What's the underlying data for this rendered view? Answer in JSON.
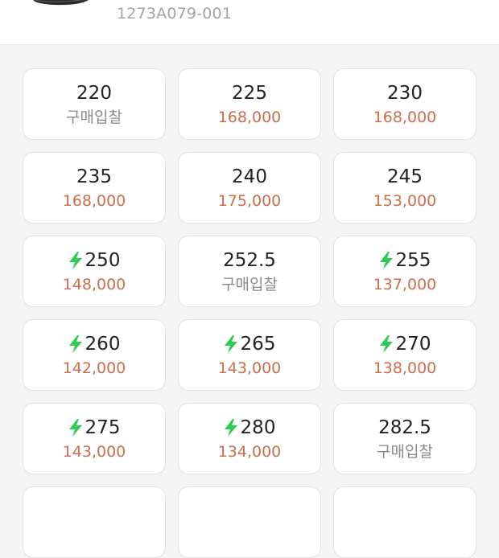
{
  "header": {
    "model_code": "1273A079-001",
    "thumbnail_icon": "shoe-thumbnail"
  },
  "colors": {
    "price": "#cc6e4c",
    "bid_text": "#8a8a8a",
    "fast_delivery": "#2ecc54"
  },
  "sizes": [
    {
      "size": "220",
      "price": "구매입찰",
      "fast": false,
      "bid": true
    },
    {
      "size": "225",
      "price": "168,000",
      "fast": false,
      "bid": false
    },
    {
      "size": "230",
      "price": "168,000",
      "fast": false,
      "bid": false
    },
    {
      "size": "235",
      "price": "168,000",
      "fast": false,
      "bid": false
    },
    {
      "size": "240",
      "price": "175,000",
      "fast": false,
      "bid": false
    },
    {
      "size": "245",
      "price": "153,000",
      "fast": false,
      "bid": false
    },
    {
      "size": "250",
      "price": "148,000",
      "fast": true,
      "bid": false
    },
    {
      "size": "252.5",
      "price": "구매입찰",
      "fast": false,
      "bid": true
    },
    {
      "size": "255",
      "price": "137,000",
      "fast": true,
      "bid": false
    },
    {
      "size": "260",
      "price": "142,000",
      "fast": true,
      "bid": false
    },
    {
      "size": "265",
      "price": "143,000",
      "fast": true,
      "bid": false
    },
    {
      "size": "270",
      "price": "138,000",
      "fast": true,
      "bid": false
    },
    {
      "size": "275",
      "price": "143,000",
      "fast": true,
      "bid": false
    },
    {
      "size": "280",
      "price": "134,000",
      "fast": true,
      "bid": false
    },
    {
      "size": "282.5",
      "price": "구매입찰",
      "fast": false,
      "bid": true
    },
    {
      "size": "",
      "price": "",
      "fast": false,
      "bid": false
    },
    {
      "size": "",
      "price": "",
      "fast": false,
      "bid": false
    },
    {
      "size": "",
      "price": "",
      "fast": false,
      "bid": false
    }
  ]
}
